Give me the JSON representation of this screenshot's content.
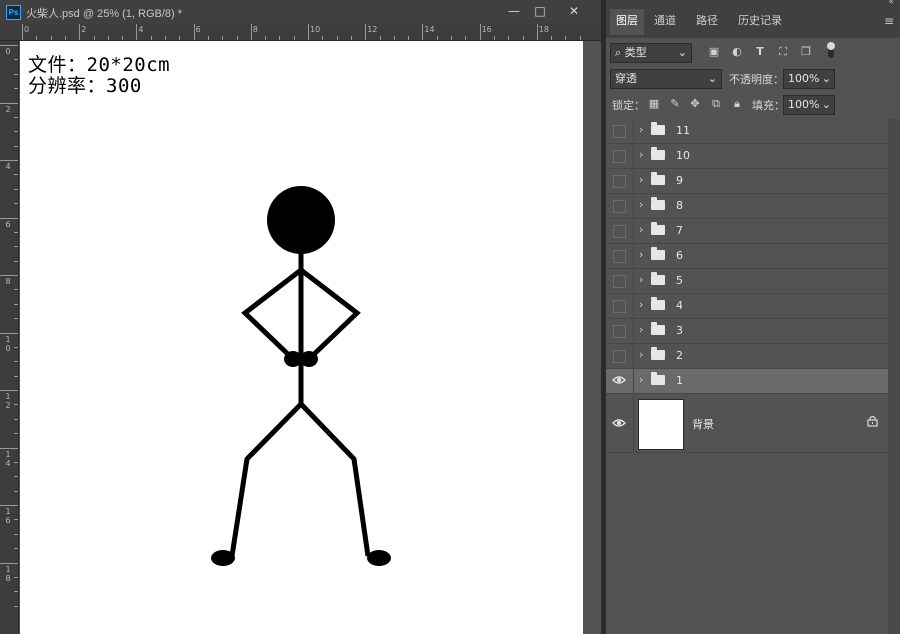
{
  "document": {
    "tab_title": "火柴人.psd @ 25% (1, RGB/8) *",
    "app_badge": "Ps",
    "window_buttons": [
      "—",
      "□",
      "✕"
    ],
    "ruler_top_labels": [
      "0",
      "2",
      "4",
      "6",
      "8",
      "10",
      "12",
      "14",
      "16",
      "18"
    ],
    "ruler_left_labels": [
      "0",
      "2",
      "4",
      "6",
      "8",
      "10",
      "12",
      "14",
      "16",
      "18"
    ],
    "canvas_text_line1": "文件：20*20cm",
    "canvas_text_line2": "分辨率：300"
  },
  "panel": {
    "tabs": [
      "图层",
      "通道",
      "路径",
      "历史记录"
    ],
    "active_tab": "图层",
    "filter_label": "类型",
    "blend_mode": "穿透",
    "opacity_label": "不透明度：",
    "opacity_value": "100%",
    "lock_label": "锁定：",
    "fill_label": "填充：",
    "fill_value": "100%",
    "layers": [
      {
        "name": "11",
        "visible": false,
        "selected": false
      },
      {
        "name": "10",
        "visible": false,
        "selected": false
      },
      {
        "name": "9",
        "visible": false,
        "selected": false
      },
      {
        "name": "8",
        "visible": false,
        "selected": false
      },
      {
        "name": "7",
        "visible": false,
        "selected": false
      },
      {
        "name": "6",
        "visible": false,
        "selected": false
      },
      {
        "name": "5",
        "visible": false,
        "selected": false
      },
      {
        "name": "4",
        "visible": false,
        "selected": false
      },
      {
        "name": "3",
        "visible": false,
        "selected": false
      },
      {
        "name": "2",
        "visible": false,
        "selected": false
      },
      {
        "name": "1",
        "visible": true,
        "selected": true
      }
    ],
    "background_layer": {
      "name": "背景",
      "visible": true,
      "locked": true
    }
  },
  "colors": {
    "canvas_bg": "#ffffff",
    "ui_dark": "#404040",
    "ui_mid": "#535353",
    "selected_row": "#6a6a6a",
    "figure": "#000000"
  }
}
